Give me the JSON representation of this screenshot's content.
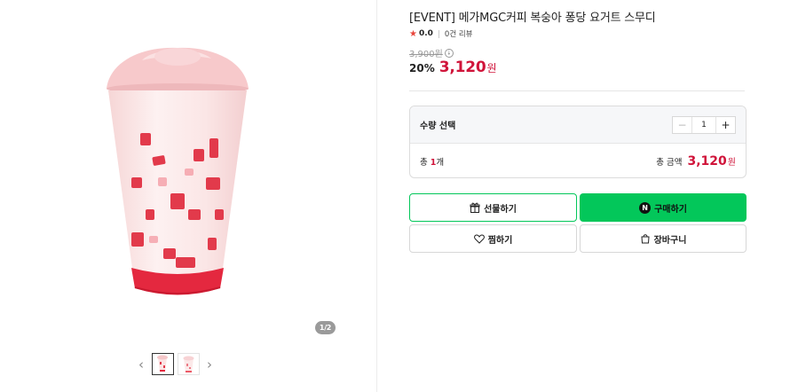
{
  "gallery": {
    "page_indicator": "1/2",
    "prev_icon": "chevron-left-icon",
    "next_icon": "chevron-right-icon",
    "thumbnails": [
      "thumb-1",
      "thumb-2"
    ],
    "selected_thumbnail": 1
  },
  "product": {
    "title": "[EVENT] 메가MGC커피 복숭아 퐁당 요거트 스무디",
    "rating": "0.0",
    "reviews": "0건 리뷰",
    "original_price": "3,900원",
    "discount": "20%",
    "sale_price": "3,120",
    "currency": "원"
  },
  "quantity": {
    "label": "수량 선택",
    "minus": "−",
    "value": "1",
    "plus": "+",
    "total_prefix": "총 ",
    "total_count": "1",
    "total_suffix": "개",
    "total_amount_label": "총 금액",
    "total_amount": "3,120",
    "currency": "원"
  },
  "actions": {
    "gift": "선물하기",
    "buy": "구매하기",
    "buy_badge": "N",
    "wish": "찜하기",
    "cart": "장바구니"
  },
  "colors": {
    "accent_red": "#d0143a",
    "naver_green": "#03c75a",
    "star": "#e8453c"
  }
}
